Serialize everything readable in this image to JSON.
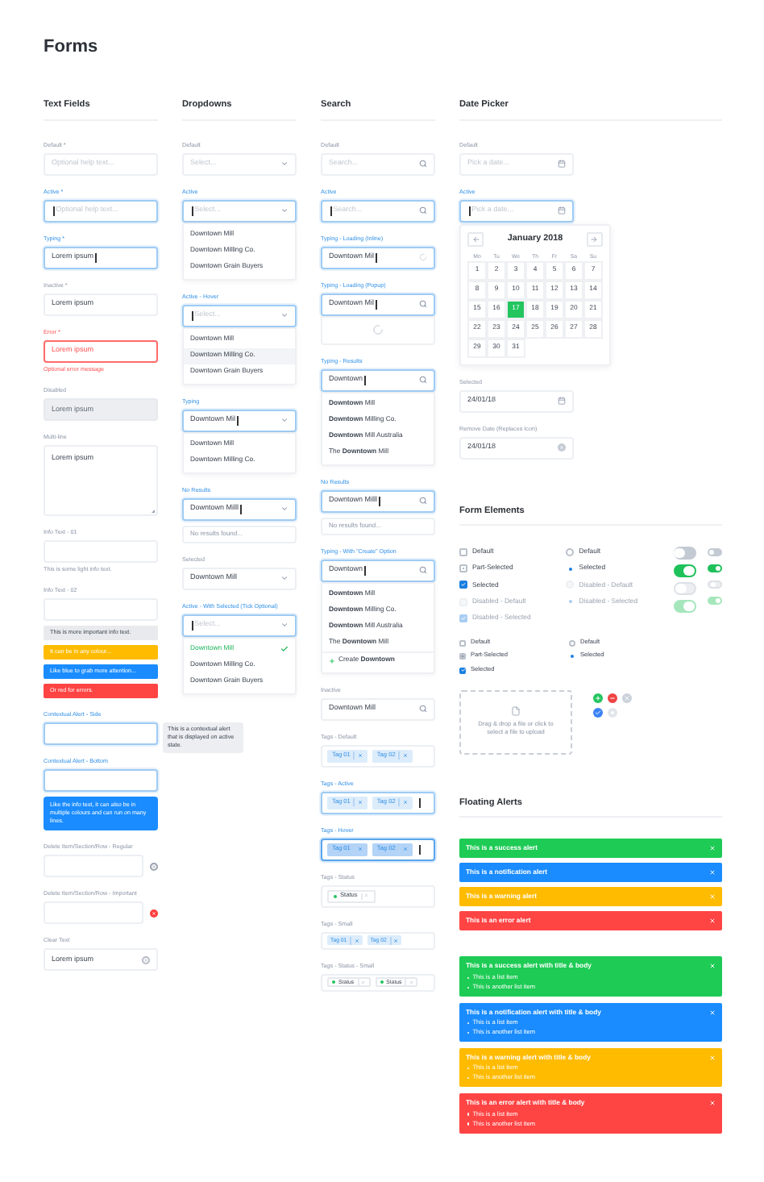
{
  "title": "Forms",
  "text_fields": {
    "heading": "Text Fields",
    "items": [
      {
        "kind": "field",
        "label": "Default *",
        "focused": false,
        "error": false,
        "disabled": false,
        "placeholder": "Optional help text..."
      },
      {
        "kind": "field",
        "label": "Active *",
        "focused": true,
        "error": false,
        "disabled": false,
        "placeholder": "Optional help text..."
      },
      {
        "kind": "field",
        "label": "Typing *",
        "focused": true,
        "error": false,
        "disabled": false,
        "value": "Lorem ipsum"
      },
      {
        "kind": "field",
        "label": "Inactive *",
        "focused": false,
        "error": false,
        "disabled": false,
        "value": "Lorem ipsum"
      },
      {
        "kind": "field",
        "label": "Error *",
        "focused": false,
        "error": true,
        "disabled": false,
        "value": "Lorem ipsum",
        "message": "Optional error message"
      },
      {
        "kind": "field",
        "label": "Disabled",
        "focused": false,
        "error": false,
        "disabled": true,
        "value": "Lorem ipsum"
      },
      {
        "kind": "textarea",
        "label": "Multi-line",
        "focused": false,
        "error": false,
        "disabled": false,
        "value": "Lorem ipsum"
      },
      {
        "kind": "field",
        "label": "Info Text - 01",
        "focused": false,
        "error": false,
        "disabled": false,
        "message": "This is some light info text."
      },
      {
        "kind": "field",
        "label": "Info Text - 02",
        "focused": false,
        "error": false,
        "disabled": false,
        "notes": [
          {
            "kind": "info",
            "text": "This is more important info text."
          },
          {
            "kind": "warning",
            "text": "It can be in any colour..."
          },
          {
            "kind": "notification",
            "text": "Like blue to grab more attention..."
          },
          {
            "kind": "error",
            "text": "Or red for errors."
          }
        ]
      },
      {
        "kind": "field",
        "label": "Contextual Alert - Side",
        "focused": true,
        "error": false,
        "disabled": false,
        "side_alert": "This is a contextual alert that is displayed on active state."
      },
      {
        "kind": "field",
        "label": "Contextual Alert - Bottom",
        "focused": true,
        "error": false,
        "disabled": false,
        "bottom_alert": "Like the info text, it can also be in multiple colours and can run on many lines."
      },
      {
        "kind": "delete",
        "label": "Delete Item/Section/Row - Regular",
        "focused": false,
        "error": false,
        "disabled": false,
        "important": false
      },
      {
        "kind": "delete",
        "label": "Delete Item/Section/Row - Important",
        "focused": false,
        "error": false,
        "disabled": false,
        "important": true
      },
      {
        "kind": "clear",
        "label": "Clear Text",
        "focused": false,
        "error": false,
        "disabled": false,
        "value": "Lorem ipsum"
      }
    ]
  },
  "dropdowns": {
    "heading": "Dropdowns",
    "items": [
      {
        "label": "Default",
        "focused": false,
        "placeholder": "Select..."
      },
      {
        "label": "Active",
        "focused": true,
        "placeholder": "Select...",
        "options": [
          {
            "label": "Downtown Mill",
            "hovered": false,
            "selected": false
          },
          {
            "label": "Downtown Milling Co.",
            "hovered": false,
            "selected": false
          },
          {
            "label": "Downtown Grain Buyers",
            "hovered": false,
            "selected": false
          }
        ]
      },
      {
        "label": "Active - Hover",
        "focused": true,
        "placeholder": "Select...",
        "options": [
          {
            "label": "Downtown Mill",
            "hovered": false,
            "selected": false
          },
          {
            "label": "Downtown Milling Co.",
            "hovered": true,
            "selected": false
          },
          {
            "label": "Downtown Grain Buyers",
            "hovered": false,
            "selected": false
          }
        ]
      },
      {
        "label": "Typing",
        "focused": true,
        "value": "Downtown Mil",
        "options": [
          {
            "label": "Downtown Mill",
            "hovered": false,
            "selected": false
          },
          {
            "label": "Downtown Milling Co.",
            "hovered": false,
            "selected": false
          }
        ]
      },
      {
        "label": "No Results",
        "focused": true,
        "value": "Downtown Milll",
        "empty": "No results found..."
      },
      {
        "label": "Selected",
        "focused": false,
        "value": "Downtown Mill"
      },
      {
        "label": "Active - With Selected (Tick Optional)",
        "focused": true,
        "placeholder": "Select...",
        "options": [
          {
            "label": "Downtown Mill",
            "hovered": false,
            "selected": true
          },
          {
            "label": "Downtown Milling Co.",
            "hovered": false,
            "selected": false
          },
          {
            "label": "Downtown Grain Buyers",
            "hovered": false,
            "selected": false
          }
        ]
      }
    ]
  },
  "search": {
    "heading": "Search",
    "items": [
      {
        "kind": "search",
        "label": "Default",
        "focused": false,
        "placeholder": "Search..."
      },
      {
        "kind": "search",
        "label": "Active",
        "focused": true,
        "placeholder": "Search..."
      },
      {
        "kind": "spinner",
        "label": "Typing - Loading (Inline)",
        "focused": true,
        "value": "Downtown Mil"
      },
      {
        "kind": "popup",
        "label": "Typing - Loading (Popup)",
        "focused": true,
        "value": "Downtown Mil"
      },
      {
        "kind": "search",
        "label": "Typing - Results",
        "focused": true,
        "value": "Downtown",
        "results": [
          "**Downtown** Mill",
          "**Downtown** Milling Co.",
          "**Downtown** Mill Australia",
          "The **Downtown** Mill"
        ]
      },
      {
        "kind": "search",
        "label": "No Results",
        "focused": true,
        "value": "Downtown Milll",
        "empty": "No results found..."
      },
      {
        "kind": "search",
        "label": "Typing - With \"Create\" Option",
        "focused": true,
        "value": "Downtown",
        "results": [
          "**Downtown** Mill",
          "**Downtown** Milling Co.",
          "**Downtown** Mill Australia",
          "The **Downtown** Mill"
        ],
        "create": "Create **Downtown**"
      },
      {
        "kind": "search",
        "label": "Inactive",
        "focused": false,
        "value": "Downtown Mill"
      },
      {
        "kind": "tags",
        "label": "Tags - Default",
        "focused": false,
        "hovered": false,
        "tags": [
          "Tag 01",
          "Tag 02"
        ]
      },
      {
        "kind": "tags",
        "label": "Tags - Active",
        "focused": true,
        "hovered": false,
        "tags": [
          "Tag 01",
          "Tag 02"
        ]
      },
      {
        "kind": "tags",
        "label": "Tags - Hover",
        "focused": true,
        "hovered": true,
        "tags": [
          "Tag 01",
          "Tag 02"
        ]
      },
      {
        "kind": "status",
        "label": "Tags - Status",
        "focused": false,
        "tags": [
          {
            "label": "Status",
            "color": "#22c55e"
          }
        ]
      },
      {
        "kind": "minitags",
        "label": "Tags - Small",
        "focused": false,
        "hovered": false,
        "tags": [
          "Tag 01",
          "Tag 02"
        ]
      },
      {
        "kind": "ministatus",
        "label": "Tags - Status - Small",
        "focused": false,
        "tags": [
          {
            "label": "Status",
            "color": "#22c55e"
          },
          {
            "label": "Status",
            "color": "#22c55e"
          }
        ]
      }
    ]
  },
  "date_picker": {
    "heading": "Date Picker",
    "items": [
      {
        "kind": "date",
        "label": "Default",
        "focused": false,
        "placeholder": "Pick a date..."
      },
      {
        "kind": "date",
        "label": "Active",
        "focused": true,
        "placeholder": "Pick a date...",
        "calendar": {
          "month": "January 2018",
          "weekdays": [
            "Mo",
            "Tu",
            "We",
            "Th",
            "Fr",
            "Sa",
            "Su"
          ],
          "days": [
            {
              "label": "1",
              "selected": false
            },
            {
              "label": "2",
              "selected": false
            },
            {
              "label": "3",
              "selected": false
            },
            {
              "label": "4",
              "selected": false
            },
            {
              "label": "5",
              "selected": false
            },
            {
              "label": "6",
              "selected": false
            },
            {
              "label": "7",
              "selected": false
            },
            {
              "label": "8",
              "selected": false
            },
            {
              "label": "9",
              "selected": false
            },
            {
              "label": "10",
              "selected": false
            },
            {
              "label": "11",
              "selected": false
            },
            {
              "label": "12",
              "selected": false
            },
            {
              "label": "13",
              "selected": false
            },
            {
              "label": "14",
              "selected": false
            },
            {
              "label": "15",
              "selected": false
            },
            {
              "label": "16",
              "selected": false
            },
            {
              "label": "17",
              "selected": true
            },
            {
              "label": "18",
              "selected": false
            },
            {
              "label": "19",
              "selected": false
            },
            {
              "label": "20",
              "selected": false
            },
            {
              "label": "21",
              "selected": false
            },
            {
              "label": "22",
              "selected": false
            },
            {
              "label": "23",
              "selected": false
            },
            {
              "label": "24",
              "selected": false
            },
            {
              "label": "25",
              "selected": false
            },
            {
              "label": "26",
              "selected": false
            },
            {
              "label": "27",
              "selected": false
            },
            {
              "label": "28",
              "selected": false
            },
            {
              "label": "29",
              "selected": false
            },
            {
              "label": "30",
              "selected": false
            },
            {
              "label": "31",
              "selected": false
            }
          ]
        }
      },
      {
        "kind": "date",
        "label": "Selected",
        "focused": false,
        "value": "24/01/18"
      },
      {
        "kind": "clear",
        "label": "Remove Date (Replaces Icon)",
        "focused": false,
        "value": "24/01/18"
      }
    ]
  },
  "form_elements": {
    "heading": "Form Elements",
    "checkboxes": [
      {
        "label": "Default",
        "checked": false,
        "partial": false,
        "disabled": false
      },
      {
        "label": "Part-Selected",
        "checked": false,
        "partial": true,
        "disabled": false
      },
      {
        "label": "Selected",
        "checked": true,
        "partial": false,
        "disabled": false
      },
      {
        "label": "Disabled - Default",
        "checked": false,
        "partial": false,
        "disabled": true
      },
      {
        "label": "Disabled - Selected",
        "checked": true,
        "partial": false,
        "disabled": true
      }
    ],
    "radios": [
      {
        "label": "Default",
        "selected": false,
        "disabled": false
      },
      {
        "label": "Selected",
        "selected": true,
        "disabled": false
      },
      {
        "label": "Disabled - Default",
        "selected": false,
        "disabled": true
      },
      {
        "label": "Disabled - Selected",
        "selected": true,
        "disabled": true
      }
    ],
    "toggles_large": [
      {
        "on": false,
        "disabled": false
      },
      {
        "on": true,
        "disabled": false
      },
      {
        "on": false,
        "disabled": true
      },
      {
        "on": true,
        "disabled": true
      }
    ],
    "toggles_small": [
      {
        "on": false,
        "disabled": false
      },
      {
        "on": true,
        "disabled": false
      },
      {
        "on": false,
        "disabled": true
      },
      {
        "on": true,
        "disabled": true
      }
    ],
    "small_checkboxes": [
      {
        "label": "Default",
        "checked": false,
        "partial": false,
        "disabled": false
      },
      {
        "label": "Part-Selected",
        "checked": false,
        "partial": true,
        "disabled": false
      },
      {
        "label": "Selected",
        "checked": true,
        "partial": false,
        "disabled": false
      }
    ],
    "small_radios": [
      {
        "label": "Default",
        "selected": false,
        "disabled": false
      },
      {
        "label": "Selected",
        "selected": true,
        "disabled": false
      }
    ],
    "upload": {
      "text": "Drag & drop a file or click to select a file to upload"
    },
    "icon_buttons": [
      {
        "kind": "plus",
        "color": "#22c55e"
      },
      {
        "kind": "minus",
        "color": "#ef4444"
      },
      {
        "kind": "close",
        "color": "#cbd2da"
      },
      {
        "kind": "check",
        "color": "#3b82f6"
      },
      {
        "kind": "dot",
        "color": "#e2e6ea"
      }
    ]
  },
  "floating_alerts": {
    "heading": "Floating Alerts",
    "simple": [
      {
        "kind": "success",
        "text": "This is a success alert"
      },
      {
        "kind": "notification",
        "text": "This is a notification alert"
      },
      {
        "kind": "warning",
        "text": "This is a warning alert"
      },
      {
        "kind": "error",
        "text": "This is an error alert"
      }
    ],
    "detailed": [
      {
        "kind": "success",
        "title": "This is a success alert with title & body",
        "items": [
          "This is a list item",
          "This is another list item"
        ]
      },
      {
        "kind": "notification",
        "title": "This is a notification alert with title & body",
        "items": [
          "This is a list item",
          "This is another list item"
        ]
      },
      {
        "kind": "warning",
        "title": "This is a warning alert with title & body",
        "items": [
          "This is a list item",
          "This is another list item"
        ]
      },
      {
        "kind": "error",
        "title": "This is an error alert with title & body",
        "items": [
          "This is a list item",
          "This is another list item"
        ]
      }
    ]
  }
}
